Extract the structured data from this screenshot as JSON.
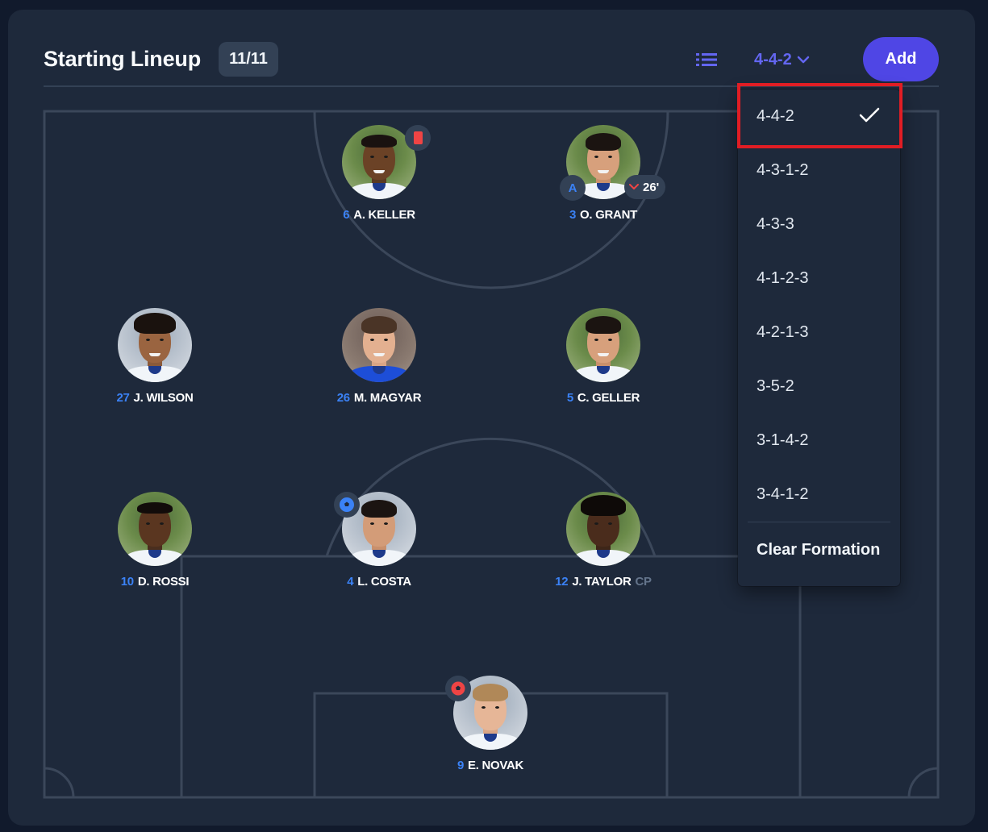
{
  "header": {
    "title": "Starting Lineup",
    "count": "11/11",
    "list_view_icon": "list-icon",
    "formation_selected": "4-4-2",
    "add_label": "Add"
  },
  "colors": {
    "background": "#111a2c",
    "card": "#1e293b",
    "accent": "#4f46e5",
    "accent_text": "#6366f1",
    "number": "#3b82f6",
    "pitch_lines": "#3b475a",
    "highlight": "#e11d24"
  },
  "players": [
    {
      "number": "6",
      "name": "A. KELLER",
      "badge": "red-card-icon"
    },
    {
      "number": "3",
      "name": "O. GRANT",
      "badge": "captain",
      "badge_text": "A",
      "sub_icon": "chevron-down-icon",
      "sub_text": "26'"
    },
    {
      "number": "27",
      "name": "J. WILSON"
    },
    {
      "number": "26",
      "name": "M. MAGYAR"
    },
    {
      "number": "5",
      "name": "C. GELLER"
    },
    {
      "number": "10",
      "name": "D. ROSSI"
    },
    {
      "number": "4",
      "name": "L. COSTA",
      "badge": "ball-icon"
    },
    {
      "number": "12",
      "name": "J. TAYLOR",
      "role": "CP"
    },
    {
      "number": "9",
      "name": "E. NOVAK",
      "badge": "own-goal-ball-icon"
    }
  ],
  "formation_menu": {
    "options": [
      "4-4-2",
      "4-3-1-2",
      "4-3-3",
      "4-1-2-3",
      "4-2-1-3",
      "3-5-2",
      "3-1-4-2",
      "3-4-1-2"
    ],
    "selected_index": 0,
    "check_icon": "check-icon",
    "clear_label": "Clear Formation"
  }
}
